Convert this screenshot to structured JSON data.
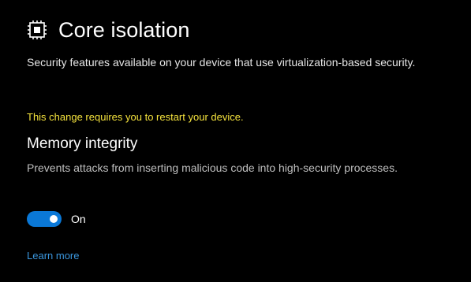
{
  "header": {
    "icon": "chip-icon",
    "title": "Core isolation"
  },
  "description": "Security features available on your device that use virtualization-based security.",
  "warning": {
    "text": "This change requires you to restart your device.",
    "color": "#f5e33d"
  },
  "memory_integrity": {
    "title": "Memory integrity",
    "description": "Prevents attacks from inserting malicious code into high-security processes.",
    "toggle": {
      "state": "on",
      "label": "On",
      "accent": "#0a78d7"
    }
  },
  "links": {
    "learn_more": "Learn more",
    "color": "#3a96dd"
  },
  "colors": {
    "background": "#000000",
    "text": "#ffffff"
  }
}
